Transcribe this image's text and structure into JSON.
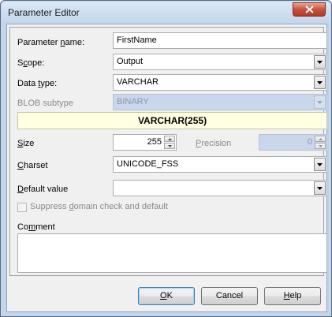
{
  "window": {
    "title": "Parameter Editor"
  },
  "form": {
    "param_name": {
      "label_pre": "Parameter ",
      "label_hot": "n",
      "label_post": "ame:",
      "value": "FirstName"
    },
    "scope": {
      "label_pre": "S",
      "label_hot": "c",
      "label_post": "ope:",
      "value": "Output"
    },
    "data_type": {
      "label_pre": "Data ",
      "label_hot": "t",
      "label_post": "ype:",
      "value": "VARCHAR"
    },
    "blob_subtype": {
      "label": "BLOB subtype",
      "value": "BINARY"
    },
    "type_summary": "VARCHAR(255)",
    "size": {
      "label_hot": "S",
      "label_post": "ize",
      "value": "255"
    },
    "precision": {
      "label_hot": "P",
      "label_post": "recision",
      "value": "0"
    },
    "charset": {
      "label_hot": "C",
      "label_post": "harset",
      "value": "UNICODE_FSS"
    },
    "default_value": {
      "label_hot": "D",
      "label_post": "efault value",
      "value": ""
    },
    "suppress": {
      "label_pre": "Suppress ",
      "label_hot": "d",
      "label_post": "omain check and default"
    },
    "comment": {
      "label_pre": "Co",
      "label_hot": "m",
      "label_post": "ment",
      "value": ""
    }
  },
  "buttons": {
    "ok": {
      "hot": "O",
      "rest": "K"
    },
    "cancel": {
      "label": "Cancel"
    },
    "help": {
      "hot": "H",
      "rest": "elp"
    }
  }
}
